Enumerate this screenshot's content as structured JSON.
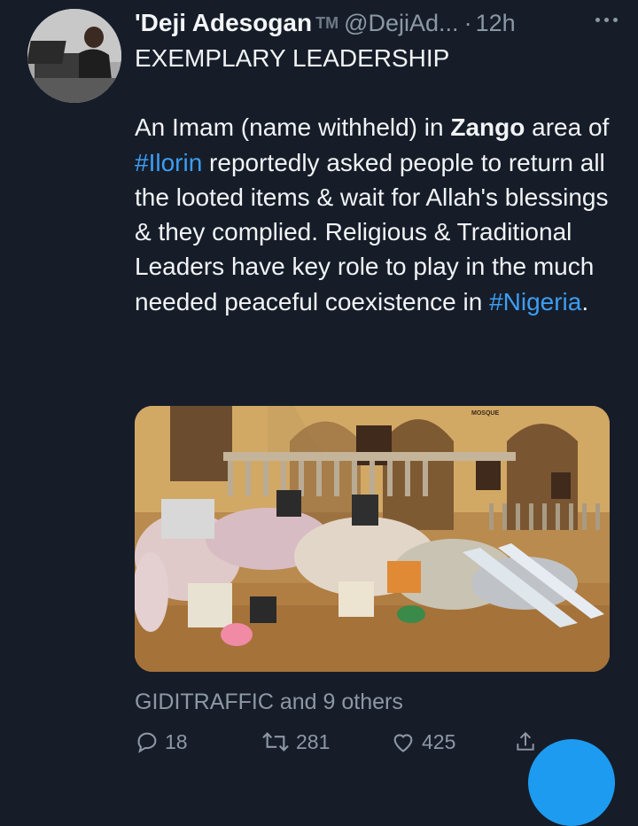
{
  "tweet": {
    "author_name": "'Deji Adesogan",
    "author_badge": "TM",
    "handle": "@DejiAd...",
    "separator": "·",
    "time": "12h",
    "headline": "EXEMPLARY LEADERSHIP",
    "body": {
      "p1": "An Imam (name withheld) in ",
      "zango": "Zango",
      "p2": " area of ",
      "ilorin": "#Ilorin",
      "p3": " reportedly asked people to return all the looted items & wait for Allah's blessings & they complied. Religious & Traditional Leaders have key role to play in the much needed peaceful coexistence in ",
      "nigeria": "#Nigeria",
      "p4": "."
    },
    "media_sign": "MOSQUE",
    "likes_text": "GIDITRAFFIC and 9 others",
    "reply_count": "18",
    "retweet_count": "281",
    "like_count": "425"
  },
  "colors": {
    "background": "#161d29",
    "hashtag": "#3d9df2",
    "muted": "#8d98a4",
    "fab": "#1d9bf0"
  }
}
